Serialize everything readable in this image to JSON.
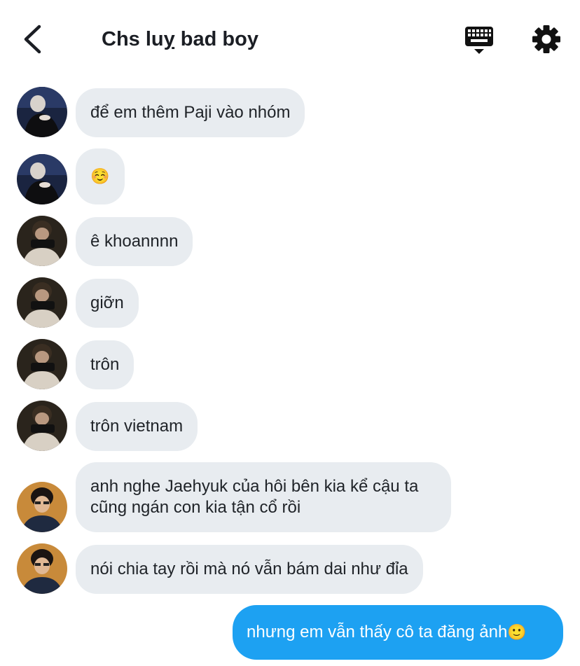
{
  "header": {
    "title": "Chs luỵ bad boy",
    "back_icon": "chevron-left-icon",
    "keyboard_icon": "keyboard-icon",
    "settings_icon": "gear-icon"
  },
  "messages": [
    {
      "sender": "avatar-1",
      "text": "để em thêm Paji vào nhóm"
    },
    {
      "sender": "avatar-1",
      "text": "☺️"
    },
    {
      "sender": "avatar-2",
      "text": "ê khoannnn"
    },
    {
      "sender": "avatar-2",
      "text": "giỡn"
    },
    {
      "sender": "avatar-2",
      "text": "trôn"
    },
    {
      "sender": "avatar-2",
      "text": "trôn vietnam"
    },
    {
      "sender": "avatar-3",
      "text": "anh nghe Jaehyuk của hôi bên kia kể cậu ta cũng ngán con kia tận cổ rồi"
    },
    {
      "sender": "avatar-3",
      "text": "nói chia tay rồi mà nó vẫn bám dai như đỉa"
    }
  ],
  "outgoing": {
    "text": "nhưng em vẫn thấy cô ta đăng ảnh",
    "emoji": "🙂"
  },
  "colors": {
    "incoming_bubble": "#e8ecf0",
    "outgoing_bubble": "#1da1f2",
    "text": "#1f2328"
  }
}
